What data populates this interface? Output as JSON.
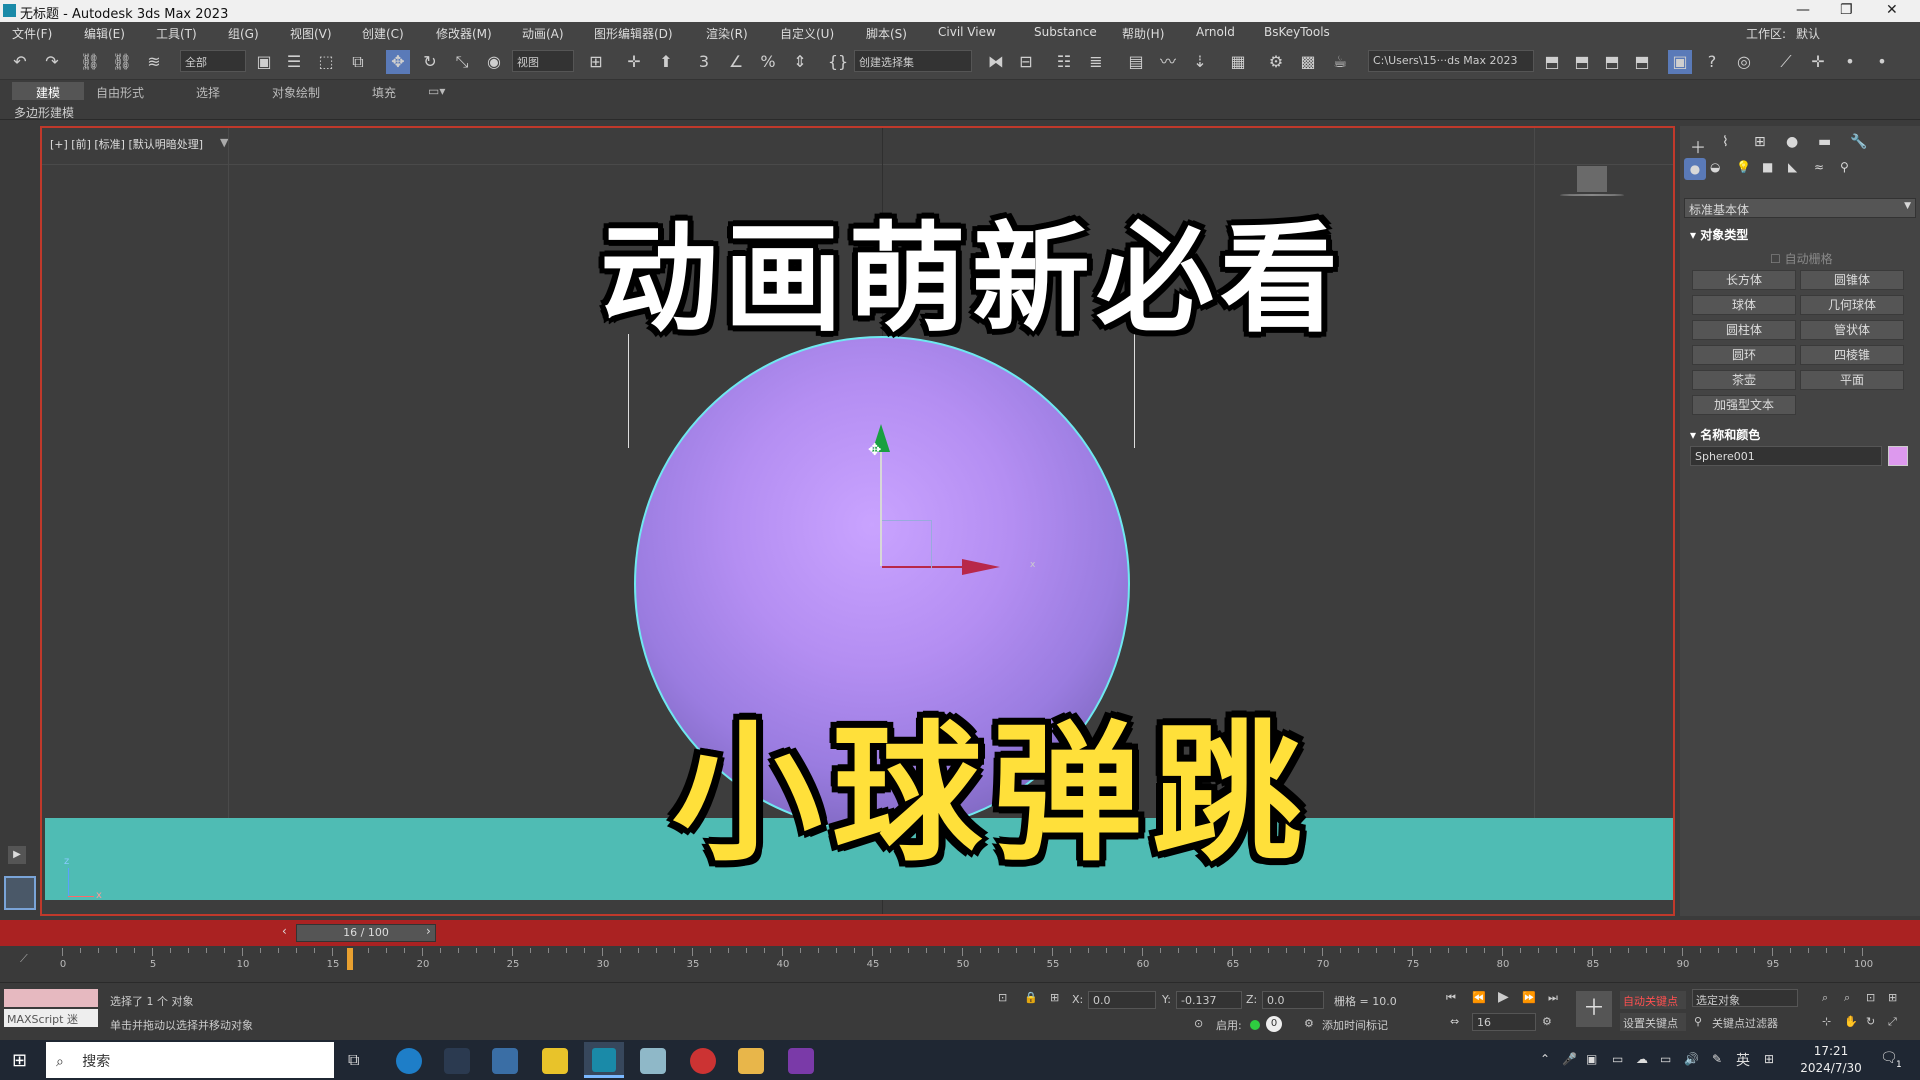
{
  "window": {
    "title": "无标题 - Autodesk 3ds Max 2023"
  },
  "menu": [
    "文件(F)",
    "编辑(E)",
    "工具(T)",
    "组(G)",
    "视图(V)",
    "创建(C)",
    "修改器(M)",
    "动画(A)",
    "图形编辑器(D)",
    "渲染(R)",
    "自定义(U)",
    "脚本(S)",
    "Civil View",
    "Substance",
    "帮助(H)",
    "Arnold",
    "BsKeyTools"
  ],
  "workspace": {
    "label": "工作区:",
    "value": "默认"
  },
  "toolbar": {
    "filter": "全部",
    "ref_coord": "视图",
    "selection_set": "创建选择集",
    "path": "C:\\Users\\15···ds Max 2023"
  },
  "ribbon": {
    "tabs": [
      "建模",
      "自由形式",
      "选择",
      "对象绘制",
      "填充"
    ],
    "subtab": "多边形建模"
  },
  "viewport": {
    "label": "[+] [前] [标准] [默认明暗处理]",
    "overlay_title": "动画萌新必看",
    "overlay_subtitle": "小球弹跳",
    "axis_x": "x",
    "axis_z": "z"
  },
  "command_panel": {
    "category": "标准基本体",
    "rollout_object_type": "对象类型",
    "autogrid": "自动栅格",
    "buttons": [
      "长方体",
      "圆锥体",
      "球体",
      "几何球体",
      "圆柱体",
      "管状体",
      "圆环",
      "四棱锥",
      "茶壶",
      "平面",
      "加强型文本"
    ],
    "rollout_name_color": "名称和颜色",
    "object_name": "Sphere001",
    "object_color": "#dd99ee"
  },
  "timeline": {
    "frame_display": "16 / 100",
    "current_frame": 16,
    "total_frames": 100,
    "ticks": [
      "0",
      "5",
      "10",
      "15",
      "20",
      "25",
      "30",
      "35",
      "40",
      "45",
      "50",
      "55",
      "60",
      "65",
      "70",
      "75",
      "80",
      "85",
      "90",
      "95",
      "100"
    ]
  },
  "status": {
    "maxscript": "MAXScript 迷",
    "selected": "选择了 1 个 对象",
    "hint": "单击并拖动以选择并移动对象",
    "x_label": "X:",
    "x": "0.0",
    "y_label": "Y:",
    "y": "-0.137",
    "z_label": "Z:",
    "z": "0.0",
    "grid": "栅格 = 10.0",
    "enable": "启用:",
    "add_time_tag": "添加时间标记",
    "auto_key": "自动关键点",
    "set_key": "设置关键点",
    "selected_object": "选定对象",
    "key_filters": "关键点过滤器",
    "frame": "16"
  },
  "taskbar": {
    "search": "搜索",
    "ime": "英",
    "time": "17:21",
    "date": "2024/7/30",
    "notifications": "1"
  }
}
